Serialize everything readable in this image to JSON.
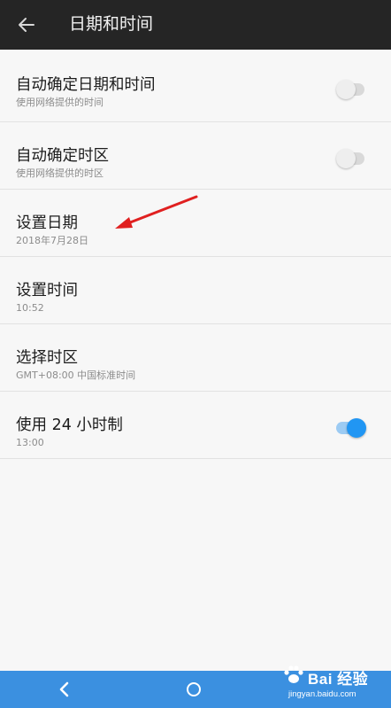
{
  "app_bar": {
    "title": "日期和时间",
    "back_icon": "arrow-left-icon"
  },
  "settings": [
    {
      "title": "自动确定日期和时间",
      "subtitle": "使用网络提供的时间",
      "toggle": "off"
    },
    {
      "title": "自动确定时区",
      "subtitle": "使用网络提供的时区",
      "toggle": "off"
    },
    {
      "title": "设置日期",
      "subtitle": "2018年7月28日"
    },
    {
      "title": "设置时间",
      "subtitle": "10:52"
    },
    {
      "title": "选择时区",
      "subtitle": "GMT+08:00 中国标准时间"
    },
    {
      "title": "使用 24 小时制",
      "subtitle": "13:00",
      "toggle": "on"
    }
  ],
  "annotation": {
    "type": "red-arrow",
    "points_to": "设置日期",
    "color": "#e02020"
  },
  "nav_bar": {
    "back_icon": "chevron-left-icon",
    "home_icon": "circle-home-icon",
    "color": "#3b90e0"
  },
  "watermark": {
    "logo": "Bai 经验",
    "url": "jingyan.baidu.com"
  },
  "colors": {
    "app_bar": "#252525",
    "background": "#f7f7f7",
    "accent": "#2196f3"
  }
}
